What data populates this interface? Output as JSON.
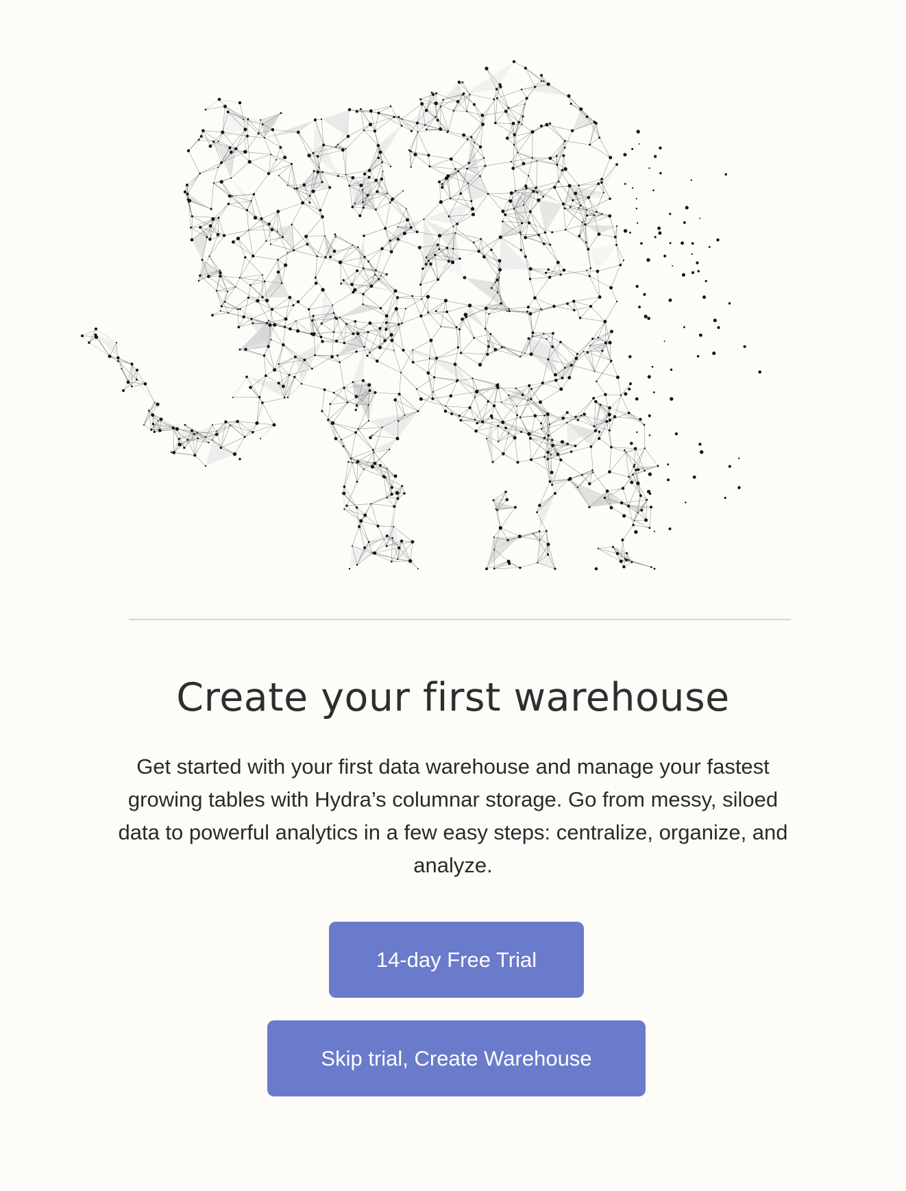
{
  "title": "Create your first warehouse",
  "description": "Get started with your first data warehouse and manage your fastest growing tables with Hydra’s columnar storage. Go from messy, siloed data to powerful analytics in a few easy steps: centralize, organize, and analyze.",
  "buttons": {
    "trial_label": "14-day Free Trial",
    "skip_label": "Skip trial, Create Warehouse"
  },
  "colors": {
    "accent": "#6a7bcb",
    "background": "#fdfcf9",
    "text": "#2b2b2b"
  },
  "illustration": {
    "icon": "network-elephant-illustration"
  }
}
